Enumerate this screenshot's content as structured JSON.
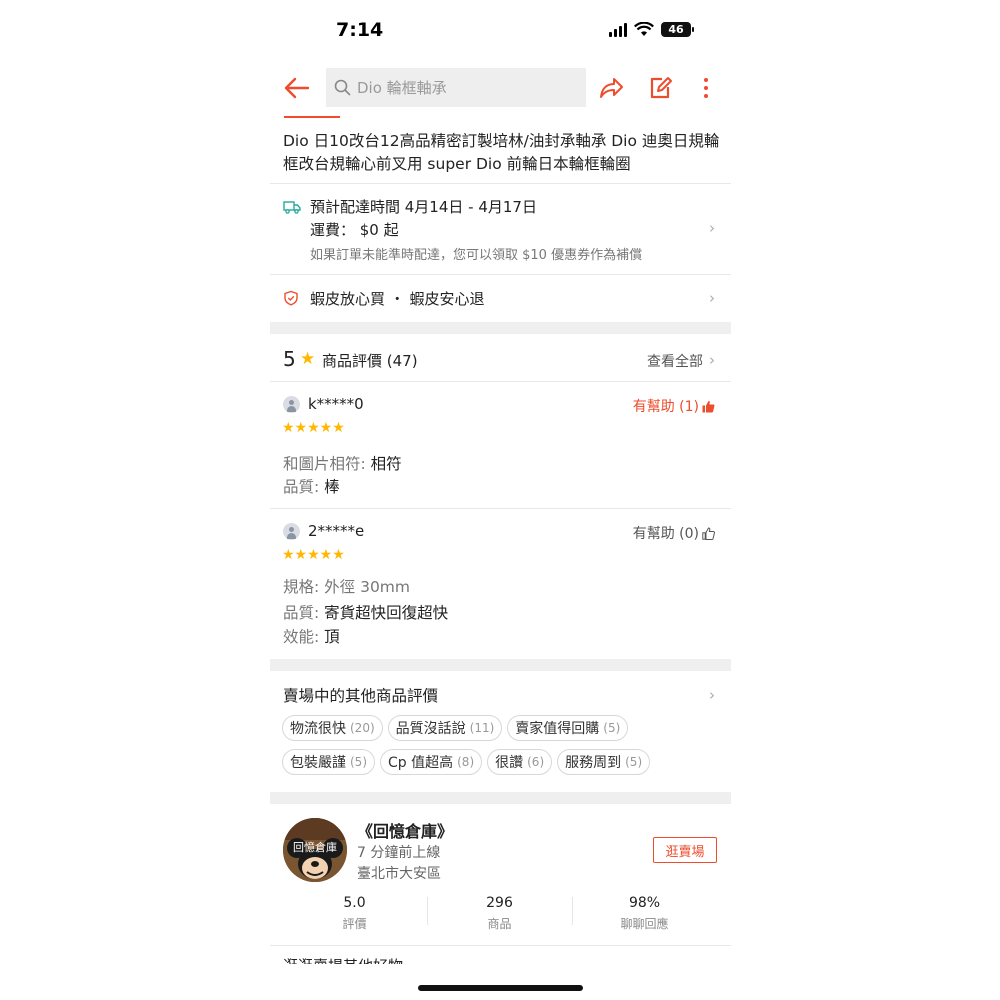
{
  "status_bar": {
    "time": "7:14",
    "battery": "46"
  },
  "header": {
    "search_placeholder": "Dio 輪框軸承",
    "icons": [
      "back-arrow-icon",
      "search-icon",
      "share-icon",
      "edit-icon",
      "more-vertical-icon"
    ]
  },
  "product": {
    "title": "Dio 日10改台12高品精密訂製培林/油封承軸承 Dio 迪奧日規輪框改台規輪心前叉用 super Dio 前輪日本輪框輪圈"
  },
  "shipping": {
    "eta": "預計配達時間 4月14日 - 4月17日",
    "fee": "運費： $0 起",
    "note": "如果訂單未能準時配達，您可以領取 $10 優惠券作為補償"
  },
  "guarantee": {
    "text": "蝦皮放心買 ・ 蝦皮安心退"
  },
  "ratings": {
    "score": "5",
    "label": "商品評價 (47)",
    "see_all": "查看全部",
    "reviews": [
      {
        "user": "k*****0",
        "helpful": "有幫助 (1)",
        "helpful_active": true,
        "stars": 5,
        "lines": [
          {
            "key": "和圖片相符: ",
            "value": "相符"
          },
          {
            "key": "品質: ",
            "value": "棒"
          }
        ]
      },
      {
        "user": "2*****e",
        "helpful": "有幫助 (0)",
        "helpful_active": false,
        "stars": 5,
        "lines": [
          {
            "key": "規格: ",
            "value": "外徑 30mm"
          },
          {
            "key": "品質: ",
            "value": "寄貨超快回復超快"
          },
          {
            "key": "效能: ",
            "value": "頂"
          }
        ]
      }
    ]
  },
  "other_reviews": {
    "title": "賣場中的其他商品評價",
    "chips_row1": [
      {
        "label": "物流很快",
        "count": "(20)"
      },
      {
        "label": "品質沒話說",
        "count": "(11)"
      },
      {
        "label": "賣家值得回購",
        "count": "(5)"
      }
    ],
    "chips_row2": [
      {
        "label": "包裝嚴謹",
        "count": "(5)"
      },
      {
        "label": "Cp 值超高",
        "count": "(8)"
      },
      {
        "label": "很讚",
        "count": "(6)"
      },
      {
        "label": "服務周到",
        "count": "(5)"
      }
    ]
  },
  "shop": {
    "avatar_label": "回憶倉庫",
    "name": "《回憶倉庫》",
    "online": "7 分鐘前上線",
    "location": "臺北市大安區",
    "visit": "逛賣場",
    "stats": [
      {
        "value": "5.0",
        "label": "評價"
      },
      {
        "value": "296",
        "label": "商品"
      },
      {
        "value": "98%",
        "label": "聊聊回應"
      }
    ]
  },
  "cutoff_text": "逛逛賣場其他好物",
  "colors": {
    "accent": "#ee4d2d",
    "star": "#ffb700",
    "ship": "#26aa99"
  }
}
